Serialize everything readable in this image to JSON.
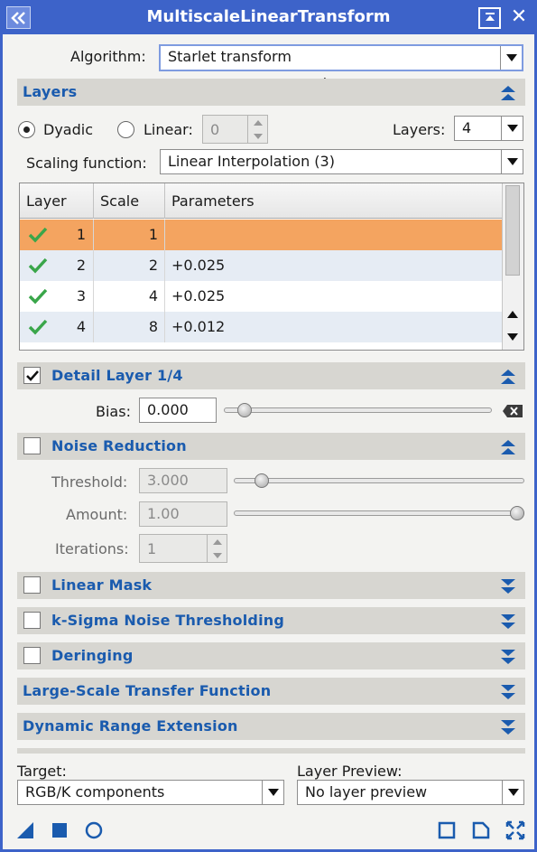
{
  "window": {
    "title": "MultiscaleLinearTransform"
  },
  "algorithm": {
    "label": "Algorithm:",
    "value": "Starlet transform"
  },
  "layers_section": {
    "title": "Layers",
    "dyadic_label": "Dyadic",
    "linear_label": "Linear:",
    "linear_value": "0",
    "layers_label": "Layers:",
    "layers_value": "4",
    "scaling_label": "Scaling function:",
    "scaling_value": "Linear Interpolation (3)",
    "table": {
      "headers": [
        "Layer",
        "Scale",
        "Parameters"
      ],
      "rows": [
        {
          "layer": "1",
          "scale": "1",
          "params": "",
          "selected": true
        },
        {
          "layer": "2",
          "scale": "2",
          "params": "+0.025",
          "selected": false
        },
        {
          "layer": "3",
          "scale": "4",
          "params": "+0.025",
          "selected": false
        },
        {
          "layer": "4",
          "scale": "8",
          "params": "+0.012",
          "selected": false
        }
      ]
    }
  },
  "detail_layer": {
    "title": "Detail Layer 1/4",
    "checked": true,
    "bias_label": "Bias:",
    "bias_value": "0.000"
  },
  "noise_reduction": {
    "title": "Noise Reduction",
    "checked": false,
    "threshold_label": "Threshold:",
    "threshold_value": "3.000",
    "amount_label": "Amount:",
    "amount_value": "1.00",
    "iterations_label": "Iterations:",
    "iterations_value": "1"
  },
  "collapsed_sections": [
    {
      "title": "Linear Mask",
      "checkbox": true
    },
    {
      "title": "k-Sigma Noise Thresholding",
      "checkbox": true
    },
    {
      "title": "Deringing",
      "checkbox": true
    },
    {
      "title": "Large-Scale Transfer Function",
      "checkbox": false
    },
    {
      "title": "Dynamic Range Extension",
      "checkbox": false
    }
  ],
  "footer": {
    "target_label": "Target:",
    "target_value": "RGB/K components",
    "preview_label": "Layer Preview:",
    "preview_value": "No layer preview"
  },
  "colors": {
    "title_bar": "#3d63c9",
    "section_title": "#1a5bae",
    "section_bg": "#d7d6d1",
    "selected_row": "#f4a460",
    "check_green": "#3aa64a"
  },
  "icons": [
    "menu-icon",
    "shade-icon",
    "close-icon",
    "new-instance-icon",
    "apply-icon",
    "apply-global-icon",
    "preview-icon",
    "reset-icon",
    "maximize-icon"
  ]
}
